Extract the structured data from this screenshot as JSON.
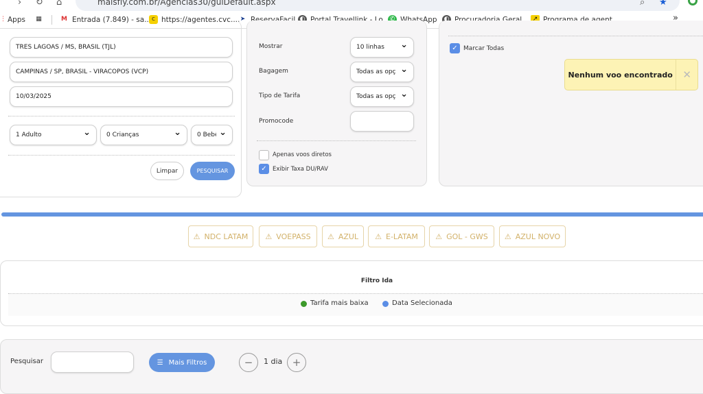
{
  "browser": {
    "url": "maisfly.com.br/Agencias30/guiDefault.aspx",
    "bookmarks": [
      {
        "label": "Apps",
        "icon": "apps-grid-icon"
      },
      {
        "label": "Entrada (7.849) - sa...",
        "icon": "gmail-icon"
      },
      {
        "label": "https://agentes.cvc....",
        "icon": "cvc-icon"
      },
      {
        "label": "ReservaFacil",
        "icon": "reservafacil-icon"
      },
      {
        "label": "Portal Travellink - Lo...",
        "icon": "globe-icon"
      },
      {
        "label": "WhatsApp",
        "icon": "whatsapp-icon"
      },
      {
        "label": "Procuradoria Geral...",
        "icon": "globe-icon"
      },
      {
        "label": "Programa de agent...",
        "icon": "arrow-logo-icon"
      }
    ],
    "more": "»"
  },
  "search": {
    "origin": "TRES LAGOAS / MS, BRASIL  (TJL)",
    "destination": "CAMPINAS / SP, BRASIL  - VIRACOPOS  (VCP)",
    "date": "10/03/2025",
    "adults": "1 Adulto",
    "children": "0 Crianças",
    "infants": "0 Bebê",
    "clear": "Limpar",
    "submit": "PESQUISAR"
  },
  "options": {
    "show_label": "Mostrar",
    "show_value": "10 linhas",
    "baggage_label": "Bagagem",
    "baggage_value": "Todas as opç",
    "fare_label": "Tipo de Tarifa",
    "fare_value": "Todas as opç",
    "promo_label": "Promocode",
    "promo_value": "",
    "direct_label": "Apenas voos diretos",
    "direct_checked": false,
    "fee_label": "Exibir Taxa DU/RAV",
    "fee_checked": true
  },
  "airlines_panel": {
    "select_all": "Marcar Todas",
    "select_all_checked": true,
    "toast": "Nenhum voo encontrado"
  },
  "accent_color": "#6495e0",
  "airlines": [
    "NDC LATAM",
    "VOEPASS",
    "AZUL",
    "E-LATAM",
    "GOL - GWS",
    "AZUL NOVO"
  ],
  "filter": {
    "title": "Filtro Ida",
    "legend": [
      {
        "label": "Tarifa mais baixa",
        "color": "#3c9a2a"
      },
      {
        "label": "Data Selecionada",
        "color": "#5b8ee6"
      }
    ]
  },
  "bottom": {
    "search_label": "Pesquisar",
    "search_value": "",
    "more_filters": "Mais Filtros",
    "days": "1 dia"
  }
}
